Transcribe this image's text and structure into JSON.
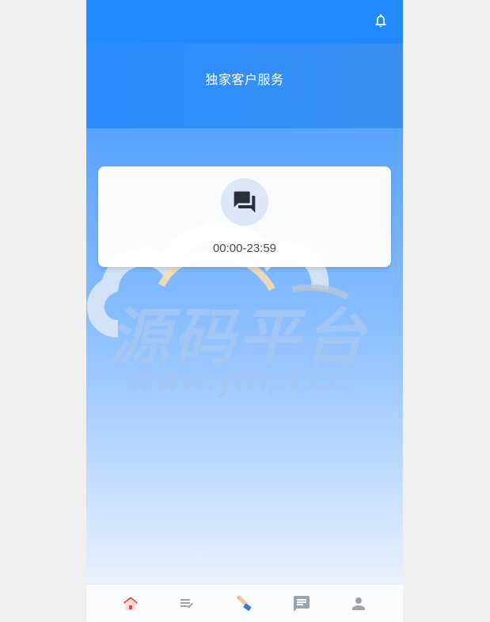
{
  "header": {
    "title": "独家客户服务",
    "notification_icon": "bell-icon"
  },
  "service_card": {
    "icon": "chat-bubbles-icon",
    "hours": "00:00-23:59"
  },
  "watermark": {
    "brand": "源码平台",
    "url": "www.ympt.cc"
  },
  "tab_bar": {
    "items": [
      {
        "icon": "home-icon",
        "active": true
      },
      {
        "icon": "task-list-icon",
        "active": false
      },
      {
        "icon": "hand-tap-icon",
        "active": false
      },
      {
        "icon": "message-icon",
        "active": false
      },
      {
        "icon": "user-icon",
        "active": false
      }
    ]
  },
  "colors": {
    "top_bar": "#218aff",
    "active_tab": "#e0443c",
    "inactive_tab": "#9aa3ae"
  }
}
